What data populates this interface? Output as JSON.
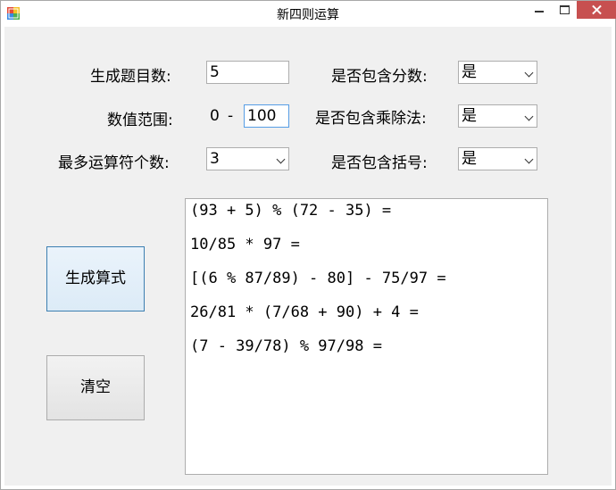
{
  "window": {
    "title": "新四则运算"
  },
  "form": {
    "count_label": "生成题目数:",
    "count_value": "5",
    "range_label": "数值范围:",
    "range_min": "0",
    "range_dash": "-",
    "range_max": "100",
    "max_ops_label": "最多运算符个数:",
    "max_ops_value": "3",
    "fraction_label": "是否包含分数:",
    "fraction_value": "是",
    "muldiv_label": "是否包含乘除法:",
    "muldiv_value": "是",
    "paren_label": "是否包含括号:",
    "paren_value": "是"
  },
  "buttons": {
    "generate_label": "生成算式",
    "clear_label": "清空"
  },
  "output": {
    "lines": [
      "(93 + 5) % (72 - 35) =",
      "10/85 * 97 =",
      "[(6 % 87/89) - 80] - 75/97 =",
      "26/81 * (7/68 + 90) + 4 =",
      "(7 - 39/78) % 97/98 ="
    ]
  },
  "icons": {
    "app": "app-icon",
    "minimize": "minimize-icon",
    "maximize": "maximize-icon",
    "close": "close-icon",
    "dropdown": "chevron-down-icon"
  }
}
